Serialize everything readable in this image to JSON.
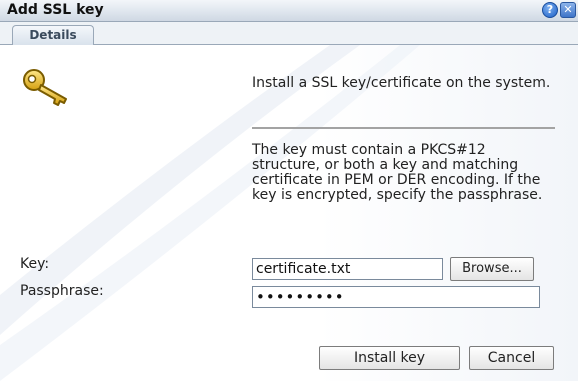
{
  "dialog": {
    "title": "Add SSL key",
    "help_icon": "question-mark-icon",
    "close_icon": "close-x-icon"
  },
  "tabs": [
    {
      "label": "Details",
      "active": true
    }
  ],
  "key_icon": "key-icon",
  "description": "Install a SSL key/certificate on the system.",
  "instructions": "The key must contain a PKCS#12 structure, or both a key and matching certificate in PEM or DER encoding. If the key is encrypted, specify the passphrase.",
  "form": {
    "key_label": "Key:",
    "key_value": "certificate.txt",
    "browse_label": "Browse...",
    "passphrase_label": "Passphrase:",
    "passphrase_value": "•••••••••"
  },
  "buttons": {
    "install_label": "Install key",
    "cancel_label": "Cancel"
  },
  "colors": {
    "accent": "#2a68c4",
    "key": "#e0b21a"
  }
}
